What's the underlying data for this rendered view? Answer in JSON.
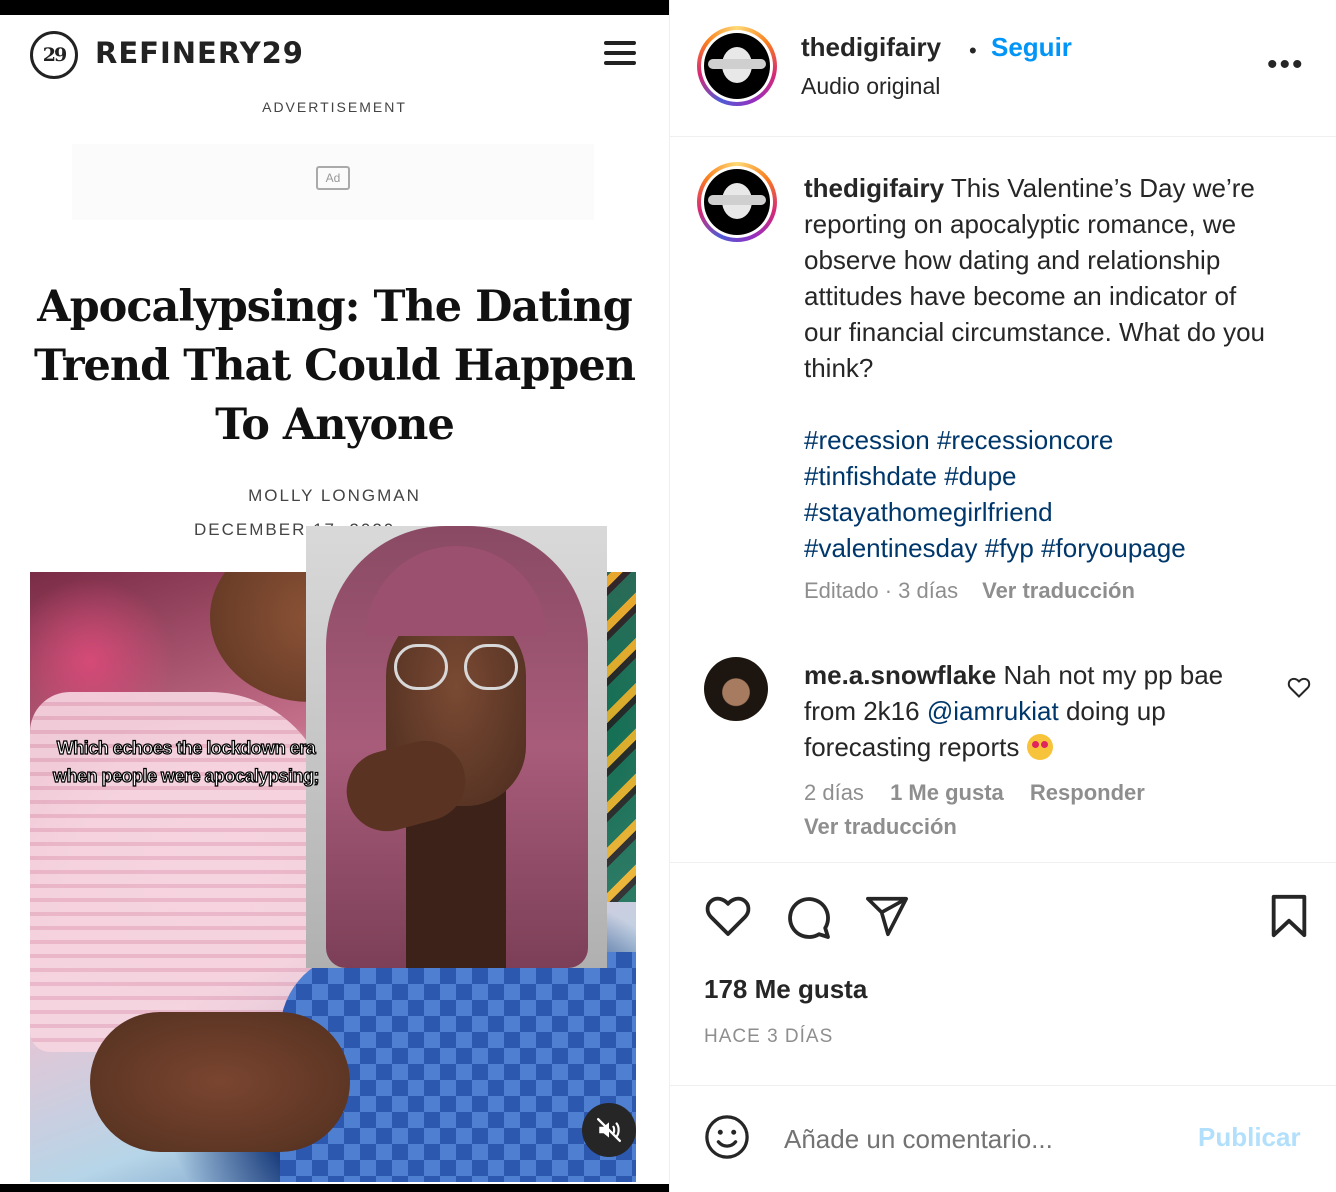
{
  "article": {
    "brand": "REFINERY29",
    "logo_mark": "29",
    "ad_label": "ADVERTISEMENT",
    "ad_badge": "Ad",
    "headline": "Apocalypsing: The Dating Trend That Could Happen To Anyone",
    "author": "MOLLY LONGMAN",
    "date": "DECEMBER 17, 2020"
  },
  "video": {
    "overlay_caption": "Which echoes the lockdown era when people were apocalypsing;",
    "mute_icon": "speaker-muted-icon"
  },
  "post": {
    "username": "thedigifairy",
    "follow_label": "Seguir",
    "separator": "•",
    "audio_label": "Audio original",
    "more_label": "•••",
    "caption_text": "This Valentine’s Day we’re reporting on apocalyptic romance, we observe how dating and relationship attitudes have become an indicator of our financial circumstance. What do you think?",
    "hashtags": [
      "#recession",
      "#recessioncore",
      "#tinfishdate",
      "#dupe",
      "#stayathomegirlfriend",
      "#valentinesday",
      "#fyp",
      "#foryoupage"
    ],
    "edited_meta": "Editado · 3 días",
    "translate_label": "Ver traducción",
    "likes": "178 Me gusta",
    "timestamp": "HACE 3 DÍAS",
    "comment_placeholder": "Añade un comentario...",
    "publish_label": "Publicar"
  },
  "comment": {
    "username": "me.a.snowflake",
    "text_before": "Nah not my pp bae from 2k16",
    "mention": "@iamrukiat",
    "text_after": "doing up forecasting reports",
    "emoji": "heart-eyes-emoji",
    "age": "2 días",
    "likes": "1 Me gusta",
    "reply_label": "Responder",
    "translate_label": "Ver traducción"
  },
  "icons": [
    "like-heart-icon",
    "comment-bubble-icon",
    "share-send-icon",
    "bookmark-icon",
    "emoji-smile-icon",
    "comment-like-heart-icon"
  ]
}
